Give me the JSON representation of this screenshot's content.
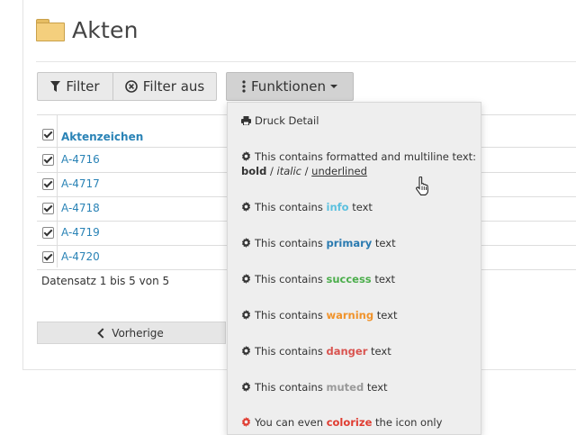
{
  "page": {
    "title": "Akten"
  },
  "toolbar": {
    "filter_label": "Filter",
    "filter_off_label": "Filter aus",
    "functions_label": "Funktionen"
  },
  "table": {
    "column_header": "Aktenzeichen",
    "rows": [
      "A-4716",
      "A-4717",
      "A-4718",
      "A-4719",
      "A-4720"
    ],
    "record_info": "Datensatz 1 bis 5 von 5"
  },
  "pager": {
    "previous_label": "Vorherige"
  },
  "menu": {
    "print_detail": "Druck Detail",
    "multiline_line1": "This contains formatted and multiline text:",
    "bold": "bold",
    "sep": " / ",
    "italic": "italic",
    "underlined": "underlined",
    "prefix": "This contains",
    "suffix": "text",
    "info": "info",
    "primary": "primary",
    "success": "success",
    "warning": "warning",
    "danger": "danger",
    "muted": "muted",
    "colorize_prefix": "You can even",
    "colorize": "colorize",
    "colorize_suffix": "the icon only"
  },
  "colors": {
    "link": "#2a83b6",
    "info": "#5bc0de",
    "primary": "#2a7ab0",
    "success": "#4cae4c",
    "warning": "#f0932b",
    "danger": "#d9534f",
    "muted": "#999999",
    "colorize_icon": "#e03c31"
  },
  "icons": [
    "folder-icon",
    "filter-icon",
    "times-circle-icon",
    "vertical-ellipsis-icon",
    "caret-down-icon",
    "print-icon",
    "gear-icon",
    "chevron-left-icon",
    "hand-pointer-icon"
  ]
}
